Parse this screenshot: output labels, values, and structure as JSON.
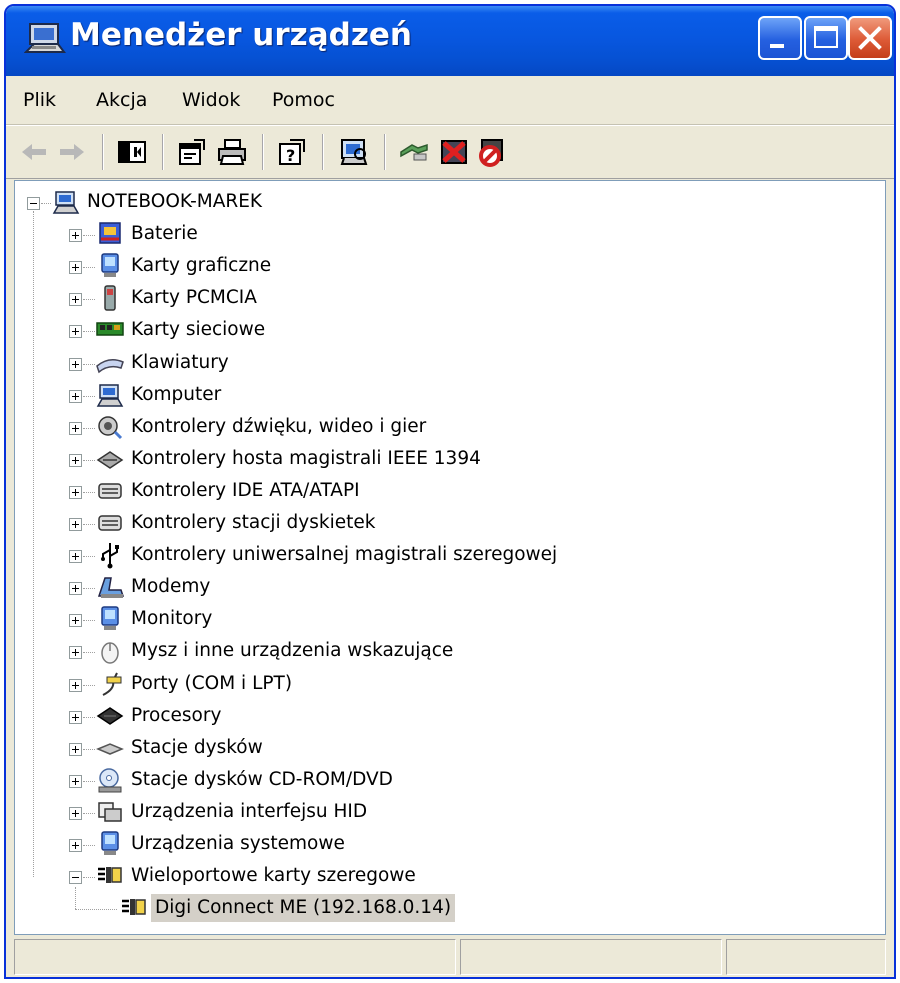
{
  "window": {
    "title": "Menedżer urządzeń",
    "buttons": [
      "minimize",
      "maximize",
      "close"
    ]
  },
  "menu": [
    {
      "label": "Plik"
    },
    {
      "label": "Akcja"
    },
    {
      "label": "Widok"
    },
    {
      "label": "Pomoc"
    }
  ],
  "toolbar": [
    "back-icon",
    "forward-icon",
    "show-hide-console-tree-icon",
    "properties-icon",
    "print-icon",
    "help-icon",
    "scan-hardware-changes-icon",
    "update-driver-icon",
    "uninstall-icon",
    "disable-icon"
  ],
  "tree": {
    "root": {
      "label": "NOTEBOOK-MAREK",
      "icon": "computer-icon",
      "expanded": true
    },
    "categories": [
      {
        "label": "Baterie",
        "icon": "battery-icon",
        "expanded": false
      },
      {
        "label": "Karty graficzne",
        "icon": "display-adapter-icon",
        "expanded": false
      },
      {
        "label": "Karty PCMCIA",
        "icon": "pcmcia-icon",
        "expanded": false
      },
      {
        "label": "Karty sieciowe",
        "icon": "network-card-icon",
        "expanded": false
      },
      {
        "label": "Klawiatury",
        "icon": "keyboard-icon",
        "expanded": false
      },
      {
        "label": "Komputer",
        "icon": "computer-icon",
        "expanded": false
      },
      {
        "label": "Kontrolery dźwięku, wideo i gier",
        "icon": "sound-icon",
        "expanded": false
      },
      {
        "label": "Kontrolery hosta magistrali IEEE 1394",
        "icon": "ieee1394-icon",
        "expanded": false
      },
      {
        "label": "Kontrolery IDE ATA/ATAPI",
        "icon": "ide-controller-icon",
        "expanded": false
      },
      {
        "label": "Kontrolery stacji dyskietek",
        "icon": "floppy-controller-icon",
        "expanded": false
      },
      {
        "label": "Kontrolery uniwersalnej magistrali szeregowej",
        "icon": "usb-icon",
        "expanded": false
      },
      {
        "label": "Modemy",
        "icon": "modem-icon",
        "expanded": false
      },
      {
        "label": "Monitory",
        "icon": "monitor-icon",
        "expanded": false
      },
      {
        "label": "Mysz i inne urządzenia wskazujące",
        "icon": "mouse-icon",
        "expanded": false
      },
      {
        "label": "Porty (COM i LPT)",
        "icon": "port-icon",
        "expanded": false
      },
      {
        "label": "Procesory",
        "icon": "processor-icon",
        "expanded": false
      },
      {
        "label": "Stacje dysków",
        "icon": "disk-drive-icon",
        "expanded": false
      },
      {
        "label": "Stacje dysków CD-ROM/DVD",
        "icon": "cdrom-icon",
        "expanded": false
      },
      {
        "label": "Urządzenia interfejsu HID",
        "icon": "hid-icon",
        "expanded": false
      },
      {
        "label": "Urządzenia systemowe",
        "icon": "system-devices-icon",
        "expanded": false
      },
      {
        "label": "Wieloportowe karty szeregowe",
        "icon": "multiport-serial-icon",
        "expanded": true,
        "children": [
          {
            "label": "Digi Connect ME (192.168.0.14)",
            "icon": "multiport-serial-icon",
            "selected": true
          }
        ]
      }
    ]
  },
  "colors": {
    "titlebar": "#0A5DE8",
    "chrome": "#ECE9D8",
    "selection": "#D4D0C8",
    "close_button": "#DD5A36"
  }
}
